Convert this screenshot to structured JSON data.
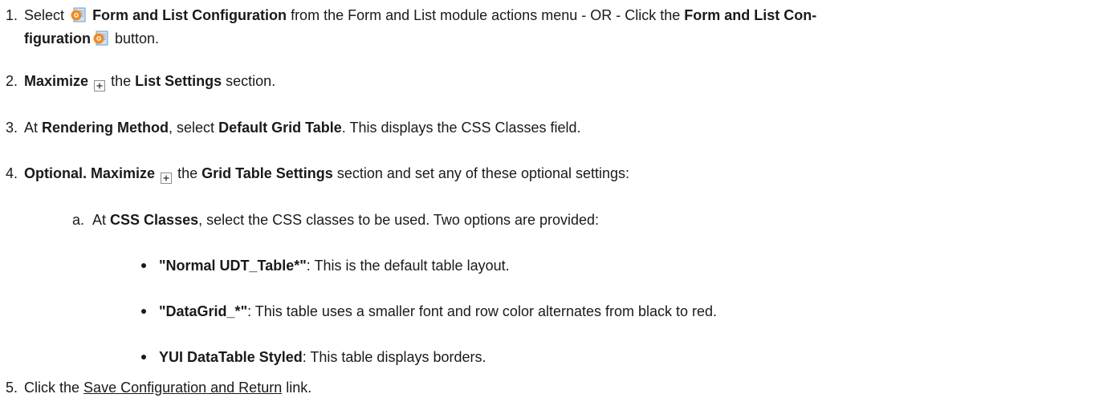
{
  "steps": [
    {
      "number": "1.",
      "line1": {
        "t1": "Select",
        "b1": "Form and List Configuration",
        "t2": "from the Form and List module actions menu - OR - Click the",
        "b2": "Form and List Con-"
      },
      "line2": {
        "b1": "figuration",
        "t1": "button."
      },
      "icon": "form-list-config-icon"
    },
    {
      "number": "2.",
      "b1": "Maximize",
      "t1": "the",
      "b2": "List Settings",
      "t2": "section.",
      "icon": "maximize-icon"
    },
    {
      "number": "3.",
      "t1": "At",
      "b1": "Rendering Method",
      "t2": ", select",
      "b2": "Default Grid Table",
      "t3": ". This displays the CSS Classes field."
    },
    {
      "number": "4.",
      "b1": "Optional. Maximize",
      "t1": "the",
      "b2": "Grid Table Settings",
      "t2": "section and set any of these optional settings:",
      "icon": "maximize-icon"
    },
    {
      "number": "5.",
      "t1": "Click the",
      "link": "Save Configuration and Return",
      "t2": "link."
    }
  ],
  "substep": {
    "letter": "a.",
    "t1": "At",
    "b1": "CSS Classes",
    "t2": ", select the CSS classes to be used. Two options are provided:"
  },
  "bullets": [
    {
      "b": "\"Normal UDT_Table*\"",
      "t": ": This is the default table layout."
    },
    {
      "b": "\"DataGrid_*\"",
      "t": ": This table uses a smaller font and row color alternates from black to red."
    },
    {
      "b": "YUI DataTable Styled",
      "t": ": This table displays borders."
    }
  ]
}
